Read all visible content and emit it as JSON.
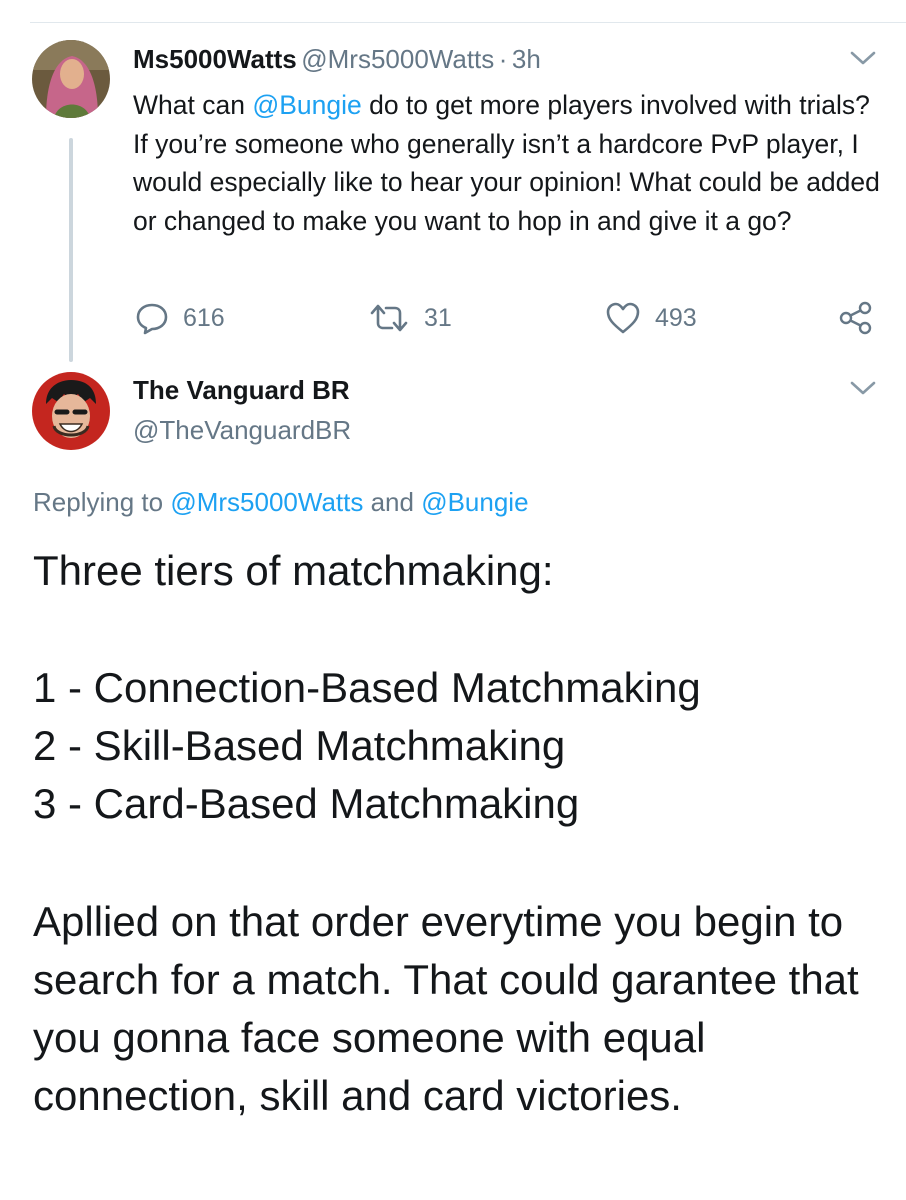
{
  "tweet1": {
    "display_name": "Ms5000Watts",
    "handle": "@Mrs5000Watts",
    "separator": "·",
    "time": "3h",
    "text_part1": "What can ",
    "mention": "@Bungie",
    "text_part2": " do to get more players involved with trials? If you’re someone who generally isn’t a hardcore PvP player, I would especially like to hear your opinion! What could be added or changed to make you want to hop in and give it a go?",
    "replies": "616",
    "retweets": "31",
    "likes": "493"
  },
  "tweet2": {
    "display_name": "The Vanguard BR",
    "handle": "@TheVanguardBR",
    "replying_prefix": "Replying to ",
    "replying_user1": "@Mrs5000Watts",
    "replying_and": " and ",
    "replying_user2": "@Bungie",
    "line_intro": "Three tiers of matchmaking:",
    "item1": "1 - Connection-Based Matchmaking",
    "item2": "2 - Skill-Based Matchmaking",
    "item3": "3 - Card-Based Matchmaking",
    "paragraph": "Apllied on that order everytime you begin to search for a match. That could garantee that you gonna face someone with equal connection, skill and card victories."
  },
  "colors": {
    "accent": "#1da1f2",
    "secondary_text": "#657786",
    "primary_text": "#14171a",
    "thread_line": "#ccd6dd"
  }
}
